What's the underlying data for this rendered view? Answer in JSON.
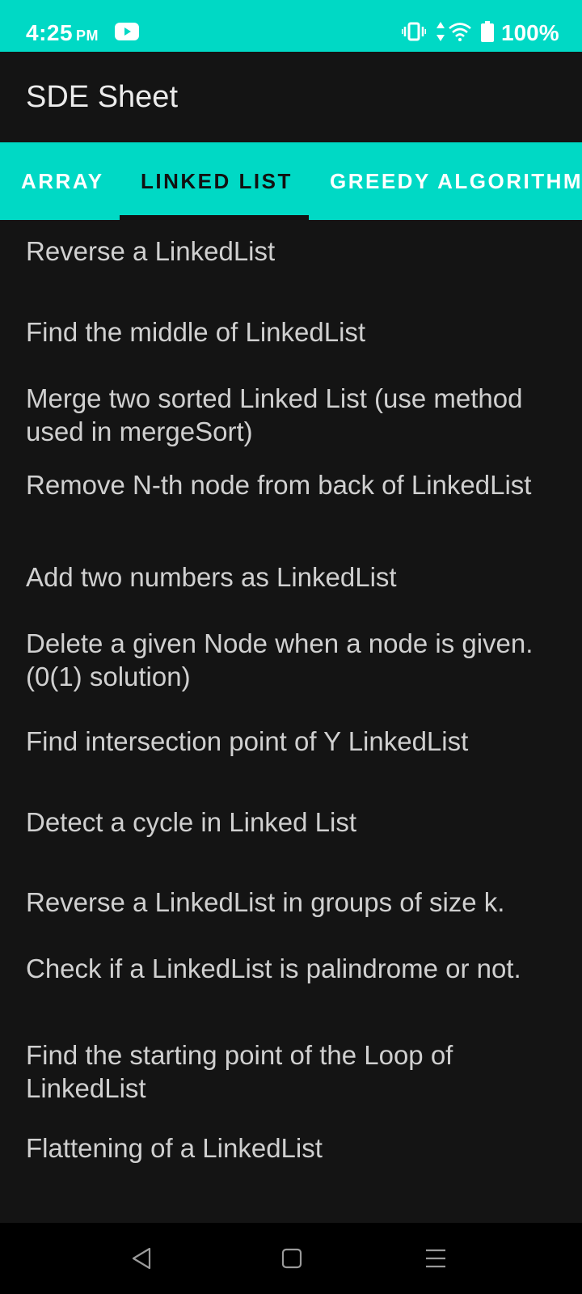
{
  "status_bar": {
    "time": "4:25",
    "ampm": "PM",
    "battery": "100%",
    "background_color": "#00d9c5",
    "icons": [
      "youtube-icon",
      "vibrate-icon",
      "mobile-data-icon",
      "wifi-icon",
      "battery-icon"
    ]
  },
  "app_bar": {
    "title": "SDE Sheet"
  },
  "tabs": {
    "items": [
      {
        "label": "ARRAY"
      },
      {
        "label": "LINKED LIST"
      },
      {
        "label": "GREEDY ALGORITHM"
      }
    ],
    "selected": "LINKED LIST",
    "accent_color": "#00d9c5"
  },
  "list": {
    "items": [
      "Reverse a LinkedList",
      "Find the middle of LinkedList",
      "Merge two sorted Linked List (use method used in mergeSort)",
      "Remove N-th node from back of LinkedList",
      "Add two numbers as LinkedList",
      "Delete a given Node when a node is given.(0(1) solution)",
      "Find intersection point of Y LinkedList",
      "Detect a cycle in Linked List",
      "Reverse a LinkedList in groups of size k.",
      "Check if a LinkedList is palindrome or not.",
      "Find the starting point of the Loop of LinkedList",
      "Flattening of a LinkedList"
    ]
  },
  "nav_bar": {
    "icons": [
      "back-icon",
      "home-icon",
      "recents-icon"
    ]
  }
}
